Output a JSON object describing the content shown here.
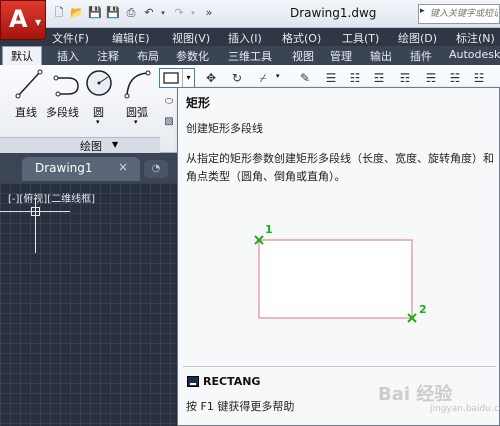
{
  "window": {
    "title": "Drawing1.dwg"
  },
  "search": {
    "placeholder": "键入关键字或短语"
  },
  "menu": [
    "文件(F)",
    "编辑(E)",
    "视图(V)",
    "插入(I)",
    "格式(O)",
    "工具(T)",
    "绘图(D)",
    "标注(N)"
  ],
  "ribbon_tabs": [
    "默认",
    "插入",
    "注释",
    "布局",
    "参数化",
    "三维工具",
    "视图",
    "管理",
    "输出",
    "插件",
    "Autodesk"
  ],
  "draw_panel": {
    "title": "绘图",
    "tools": [
      "直线",
      "多段线",
      "圆",
      "圆弧"
    ]
  },
  "file_tab": {
    "label": "Drawing1",
    "close": "×"
  },
  "viewport_label": "[-][俯视][二维线框]",
  "tooltip": {
    "title": "矩形",
    "subtitle": "创建矩形多段线",
    "description": "从指定的矩形参数创建矩形多段线（长度、宽度、旋转角度）和角点类型（圆角、倒角或直角）。",
    "point1": "1",
    "point2": "2",
    "command": "RECTANG",
    "help": "按 F1 键获得更多帮助"
  },
  "watermark": {
    "text": "Bai 经验",
    "sub": "jingyan.baidu.com"
  },
  "colors": {
    "rect_stroke": "#e8909a",
    "point_marker": "#1ab01a",
    "app_red": "#c9261b"
  }
}
